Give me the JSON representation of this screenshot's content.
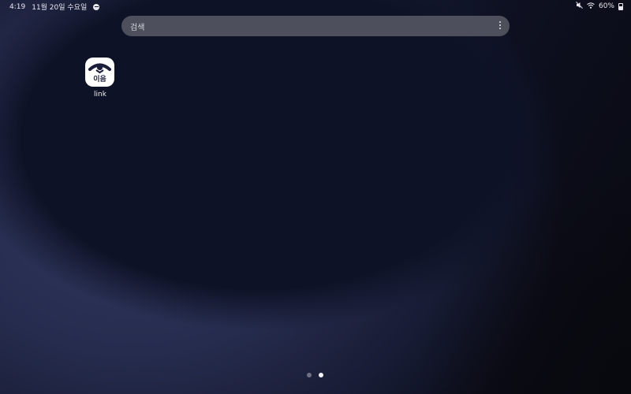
{
  "status_bar": {
    "time": "4:19",
    "date": "11월 20일 수요일",
    "battery": "60%"
  },
  "search": {
    "placeholder": "검색"
  },
  "apps": [
    {
      "label": "link",
      "logo_text": "이음",
      "icon": "ieum-link-app-icon"
    }
  ],
  "page_indicator": {
    "pages": 2,
    "active": 2
  },
  "colors": {
    "wallpaper_dark": "#0e1226",
    "wallpaper_accent": "#31385f",
    "search_bar": "#5f626c",
    "logo": "#1c1d3a"
  }
}
